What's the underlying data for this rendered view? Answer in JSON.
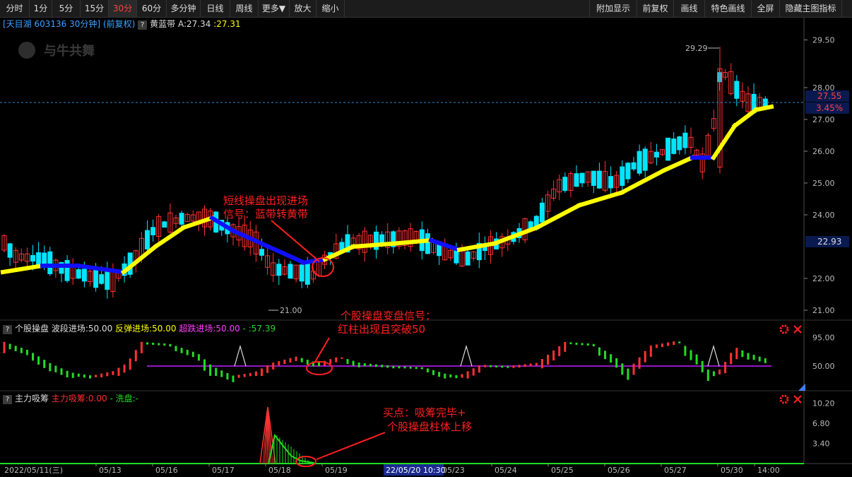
{
  "toolbar": {
    "left": [
      "分时",
      "1分",
      "5分",
      "15分",
      "30分",
      "60分",
      "多分钟",
      "日线",
      "周线",
      "更多▼",
      "放大",
      "缩小"
    ],
    "active": "30分",
    "right": [
      "附加显示",
      "前复权",
      "画线",
      "特色画线",
      "全屏",
      "隐藏主图指标"
    ]
  },
  "main_info": {
    "stock": "[天目湖 603136 30分钟]",
    "adj": "(前复权)",
    "indicator": "黄蓝带",
    "a_value": "A:27.34",
    "b_value": ":27.31"
  },
  "watermark": "与牛共舞",
  "price_axis": [
    "29.50",
    "28.00",
    "27.00",
    "26.00",
    "25.00",
    "24.00",
    "22.00",
    "21.00"
  ],
  "price_tags": {
    "current": "27.55",
    "pct": "3.45%",
    "cursor": "22.93"
  },
  "labels": {
    "high": "29.29",
    "low": "21.00"
  },
  "annotations": {
    "a1_line1": "短线操盘出现进场",
    "a1_line2": "信号：蓝带转黄带",
    "a2_line1": "个股操盘变盘信号：",
    "a2_line2": "红柱出现且突破50",
    "a3_line1": "买点：吸筹完毕+",
    "a3_line2": "个股操盘柱体上移"
  },
  "sub1_info": {
    "name": "个股操盘",
    "p1": "波段进场:50.00",
    "p2": "反弹进场:50.00",
    "p3": "超跌进场:50.00",
    "p4": "- :57.39"
  },
  "sub1_axis": [
    "95.00",
    "50.00"
  ],
  "sub2_info": {
    "name": "主力吸筹",
    "p1": "主力吸筹:0.00",
    "p2": "- 洗盘:-"
  },
  "sub2_axis": [
    "10.20",
    "6.80",
    "3.40"
  ],
  "date_axis": [
    "2022/05/11(三)",
    "05/13",
    "05/16",
    "05/17",
    "05/18",
    "05/19",
    "05/23",
    "05/24",
    "05/25",
    "05/26",
    "05/27",
    "05/30",
    "14:00"
  ],
  "cursor_date": "22/05/20 10:30",
  "colors": {
    "up": "#ff3232",
    "down": "#00e5ff",
    "yellow": "#ffff00",
    "blue": "#1010ff",
    "annot": "#ff2020",
    "purple": "#c020ff",
    "green": "#22dd22"
  },
  "icons": [
    "gear-icon",
    "close-icon"
  ]
}
